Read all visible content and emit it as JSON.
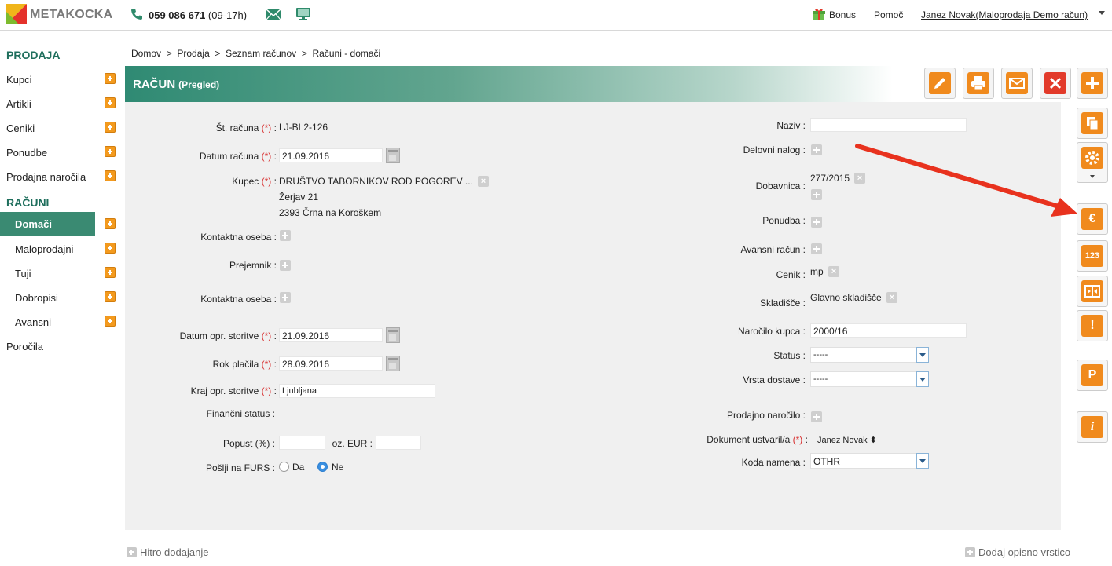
{
  "topbar": {
    "logo_text": "METAKOCKA",
    "phone": "059 086 671",
    "phone_hours": "(09-17h)",
    "bonus": "Bonus",
    "help": "Pomoč",
    "user": "Janez Novak(Maloprodaja Demo račun)"
  },
  "sidebar": {
    "section1": "PRODAJA",
    "items1": [
      {
        "label": "Kupci"
      },
      {
        "label": "Artikli"
      },
      {
        "label": "Ceniki"
      },
      {
        "label": "Ponudbe"
      },
      {
        "label": "Prodajna naročila"
      }
    ],
    "section2": "RAČUNI",
    "items2": [
      {
        "label": "Domači"
      },
      {
        "label": "Maloprodajni"
      },
      {
        "label": "Tuji"
      },
      {
        "label": "Dobropisi"
      },
      {
        "label": "Avansni"
      }
    ],
    "reports": "Poročila"
  },
  "breadcrumb": [
    "Domov",
    "Prodaja",
    "Seznam računov",
    "Računi - domači"
  ],
  "breadcrumb_sep": ">",
  "header": {
    "title": "RAČUN",
    "subtitle": "(Pregled)"
  },
  "form_left": {
    "st_racuna_label": "Št. računa",
    "st_racuna": "LJ-BL2-126",
    "datum_racuna_label": "Datum računa",
    "datum_racuna": "21.09.2016",
    "kupec_label": "Kupec",
    "kupec_name": "DRUŠTVO TABORNIKOV ROD POGOREV ...",
    "kupec_street": "Žerjav 21",
    "kupec_city": "2393 Črna na Koroškem",
    "kontaktna_oseba_label": "Kontaktna oseba :",
    "prejemnik_label": "Prejemnik :",
    "kontaktna_oseba2_label": "Kontaktna oseba :",
    "datum_opr_label": "Datum opr. storitve",
    "datum_opr": "21.09.2016",
    "rok_placila_label": "Rok plačila",
    "rok_placila": "28.09.2016",
    "kraj_opr_label": "Kraj opr. storitve",
    "kraj_opr": "Ljubljana",
    "financni_status_label": "Finančni status :",
    "popust_label": "Popust (%) :",
    "popust_value": "",
    "oz_eur_label": "oz. EUR :",
    "eur_value": "",
    "furs_label": "Pošlji na FURS :",
    "furs_da": "Da",
    "furs_ne": "Ne",
    "furs_selected": "Ne",
    "required_mark": "(*)",
    "colon": ":"
  },
  "form_right": {
    "naziv_label": "Naziv :",
    "naziv": "",
    "delovni_nalog_label": "Delovni nalog :",
    "dobavnica_label": "Dobavnica :",
    "dobavnica": "277/2015",
    "ponudba_label": "Ponudba :",
    "avansni_label": "Avansni račun :",
    "cenik_label": "Cenik :",
    "cenik": "mp",
    "skladisce_label": "Skladišče :",
    "skladisce": "Glavno skladišče",
    "narocilo_kupca_label": "Naročilo kupca :",
    "narocilo_kupca": "2000/16",
    "status_label": "Status :",
    "status": "-----",
    "vrsta_dostave_label": "Vrsta dostave :",
    "vrsta_dostave": "-----",
    "prodajno_narocilo_label": "Prodajno naročilo :",
    "dokument_label": "Dokument ustvaril/a",
    "dokument": "Janez Novak",
    "koda_namena_label": "Koda namena :",
    "koda_namena": "OTHR"
  },
  "side_tools": {
    "euro": "€",
    "numbers": "123",
    "warn": "!",
    "parking": "P",
    "info": "i"
  },
  "bottom": {
    "quick_add": "Hitro dodajanje",
    "add_line": "Dodaj opisno vrstico"
  },
  "colors": {
    "accent": "#3a8a72",
    "orange": "#f08a1d",
    "red": "#e23a2a",
    "annotation_arrow": "#e8321e"
  }
}
